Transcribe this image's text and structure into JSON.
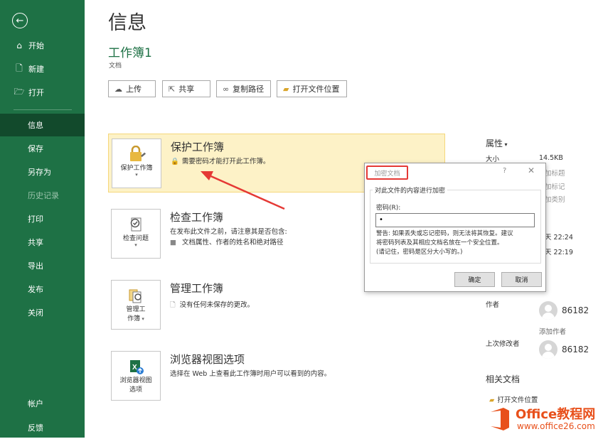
{
  "sidebar": {
    "back_icon": "back-arrow-icon",
    "items": [
      {
        "label": "开始",
        "icon": "home-icon"
      },
      {
        "label": "新建",
        "icon": "new-document-icon"
      },
      {
        "label": "打开",
        "icon": "open-folder-icon"
      },
      {
        "label": "信息"
      },
      {
        "label": "保存"
      },
      {
        "label": "另存为"
      },
      {
        "label": "历史记录"
      },
      {
        "label": "打印"
      },
      {
        "label": "共享"
      },
      {
        "label": "导出"
      },
      {
        "label": "发布"
      },
      {
        "label": "关闭"
      },
      {
        "label": "帐户"
      },
      {
        "label": "反馈"
      }
    ],
    "active": "信息"
  },
  "page": {
    "title": "信息",
    "workbook_name": "工作簿1",
    "workbook_location": "文档"
  },
  "toolbar": {
    "upload": "上传",
    "share": "共享",
    "copy_path": "复制路径",
    "open_location": "打开文件位置"
  },
  "cards": {
    "protect": {
      "tile": "保护工作簿",
      "title": "保护工作簿",
      "desc": "需要密码才能打开此工作簿。"
    },
    "inspect": {
      "tile": "检查问题",
      "title": "检查工作簿",
      "desc": "在发布此文件之前，请注意其是否包含:",
      "bullet": "文档属性、作者的姓名和绝对路径"
    },
    "manage": {
      "tile_line1": "管理工",
      "tile_line2": "作簿",
      "title": "管理工作簿",
      "desc": "没有任何未保存的更改。"
    },
    "browser": {
      "tile_line1": "浏览器视图",
      "tile_line2": "选项",
      "title": "浏览器视图选项",
      "desc": "选择在 Web 上查看此工作簿时用户可以看到的内容。"
    }
  },
  "properties": {
    "heading": "属性",
    "size_label": "大小",
    "size_value": "14.5KB",
    "title_partial": "加标题",
    "tag_partial": "加标记",
    "category_partial": "加类别",
    "time1_partial": "天 22:24",
    "time2_partial": "天 22:19",
    "author_label": "作者",
    "author_name": "86182",
    "add_author": "添加作者",
    "last_modified_label": "上次修改者",
    "last_modified_name": "86182",
    "related_docs": "相关文档",
    "open_location": "打开文件位置"
  },
  "dialog": {
    "title": "加密文档",
    "help": "?",
    "close": "✕",
    "group_label": "对此文件的内容进行加密",
    "password_label": "密码(R):",
    "password_value": "•",
    "warning_line1": "警告: 如果丢失或忘记密码，则无法将其恢复。建议",
    "warning_line2": "将密码列表及其相应文档名放在一个安全位置。",
    "warning_line3": "(请记住，密码是区分大小写的。)",
    "ok": "确定",
    "cancel": "取消"
  },
  "watermark": {
    "brand": "Office教程网",
    "url": "www.office26.com"
  },
  "colors": {
    "sidebar": "#1e7145",
    "active": "#124a2c",
    "highlight": "#fdf2c7",
    "annotation_red": "#e53935",
    "watermark_orange": "#e8501b"
  }
}
